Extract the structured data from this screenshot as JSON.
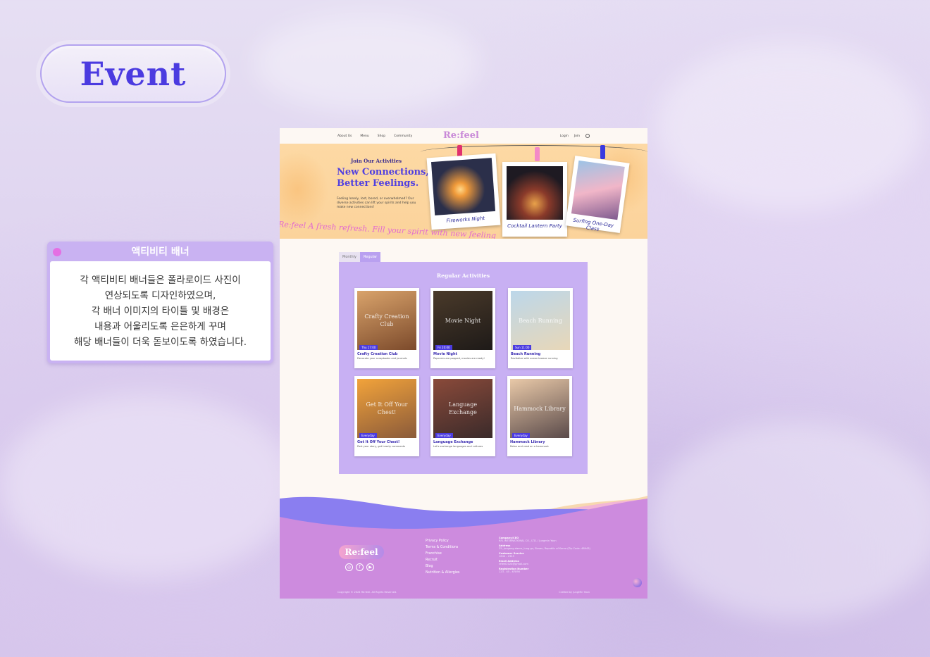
{
  "header": {
    "title": "Event"
  },
  "note": {
    "title": "액티비티 배너",
    "lines": [
      "각 액티비티 배너들은 폴라로이드 사진이",
      "연상되도록 디자인하였으며,",
      "각 배너 이미지의 타이틀 및 배경은",
      "내용과 어울리도록 은은하게 꾸며",
      "해당 배너들이 더욱 돋보이도록 하였습니다."
    ]
  },
  "site": {
    "nav": {
      "links": [
        "About Us",
        "Menu",
        "Shop",
        "Community"
      ],
      "logo": "Re:feel",
      "login": "Login",
      "join": "Join",
      "globe_icon": "globe-icon"
    },
    "banner": {
      "kicker": "Join Our Activities",
      "title_line1": "New Connections,",
      "title_line2": "Better Feelings.",
      "desc": "Feeling lonely, lost, bored, or overwhelmed? Our diverse activities can lift your spirits and help you make new connections!",
      "marquee": "Re:feel A fresh refresh. Fill your spirit with new feeling",
      "photos": [
        {
          "caption": "Fireworks Night",
          "color": "#2b2f4a"
        },
        {
          "caption": "Cocktail Lantern Party",
          "color": "#3a2a2a"
        },
        {
          "caption": "Surfing One-Day Class",
          "color": "#7aa6cf"
        }
      ]
    },
    "tabs": [
      "Monthly",
      "Regular"
    ],
    "panel_title": "Regular Activities",
    "cards": [
      {
        "overlay": "Crafty Creation Club",
        "badge": "Thu 17:00",
        "title": "Crafty Creation Club",
        "desc": "Decorate your scrapbooks and journals",
        "color1": "#d9a36b",
        "color2": "#7c4a2b"
      },
      {
        "overlay": "Movie Night",
        "badge": "Fri 20:00",
        "title": "Movie Night",
        "desc": "Popcorns are popped, movies are ready!",
        "color1": "#4a3a2a",
        "color2": "#1e1a18"
      },
      {
        "overlay": "Beach Running",
        "badge": "Sun 11:00",
        "title": "Beach Running",
        "desc": "Revitalize with ocean breeze running",
        "color1": "#bcd7ea",
        "color2": "#e8d7b8"
      },
      {
        "overlay": "Get It Off Your Chest!",
        "badge": "Everyday",
        "title": "Get It Off Your Chest!",
        "desc": "Post your story, get hearty comments",
        "color1": "#f2a33a",
        "color2": "#8a5a3a"
      },
      {
        "overlay": "Language Exchange",
        "badge": "Everyday",
        "title": "Language Exchange",
        "desc": "Let's exchange languages and cultures",
        "color1": "#8a4a3a",
        "color2": "#3a2a2a"
      },
      {
        "overlay": "Hammock Library",
        "badge": "Everyday",
        "title": "Hammock Library",
        "desc": "Relax and read on a hammock",
        "color1": "#e9c9a8",
        "color2": "#5a4a4a"
      }
    ],
    "footer": {
      "logo": "Re:feel",
      "social": [
        "instagram-icon",
        "facebook-icon",
        "youtube-icon"
      ],
      "links": [
        "Privacy Policy",
        "Terms & Conditions",
        "Franchise",
        "Recruit",
        "Blog",
        "Nutrition & Allergies"
      ],
      "info": [
        {
          "label": "Company/CEO",
          "value": "RFL INTERNATIONAL CO., LTD. / Jungmin Yoon"
        },
        {
          "label": "Address",
          "value": "25, Jungang-daero, Jung-gu, Busan, Republic of Korea (Zip Code: 48943)"
        },
        {
          "label": "Customer Service",
          "value": "1644 - 2345"
        },
        {
          "label": "Email Address",
          "value": "refeel2024@gmail.com"
        },
        {
          "label": "Registration Number",
          "value": "123 - 45 - 67890"
        }
      ],
      "copyright": "Copyright © 2024 Re:feel. All Rights Reserved.",
      "crafted": "Crafted by JungMin Yoon"
    }
  }
}
